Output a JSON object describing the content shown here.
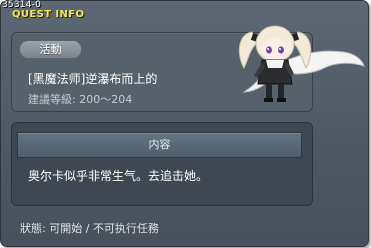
{
  "quest": {
    "id": "35314-0",
    "title": "QUEST INFO",
    "tag": "活動",
    "name": "[黑魔法师]逆瀑布而上的",
    "level": "建議等級: 200～204",
    "content_header": "内容",
    "content_text": "奥尔卡似乎非常生气。去追击她。",
    "status": "狀態: 可開始 / 不可执行任務"
  },
  "colors": {
    "title": "#f2e64f",
    "window_bg": "#56606b",
    "panel_bg": "#57616c",
    "content_bg": "#3f4852",
    "header_bg": "#5a6977"
  },
  "icons": {
    "portrait": "npc-portrait-character-icon"
  }
}
